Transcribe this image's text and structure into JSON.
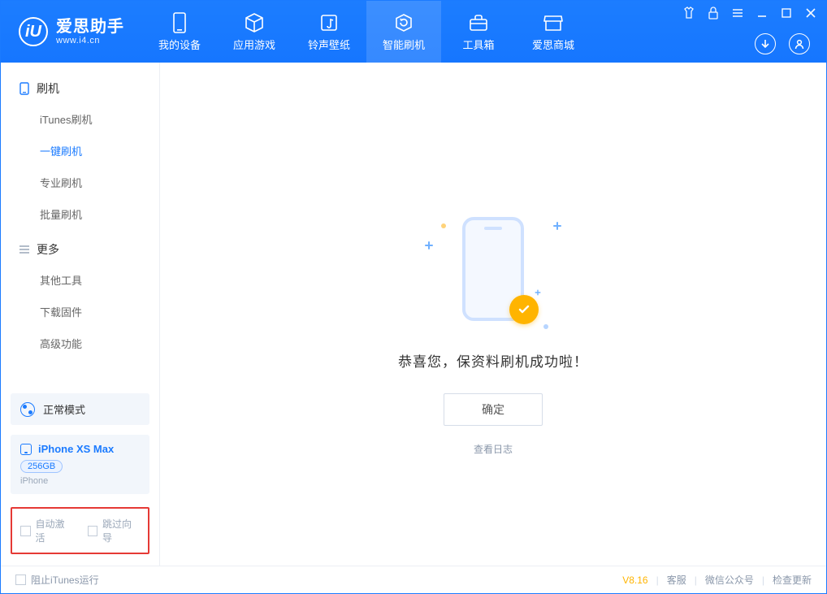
{
  "brand": {
    "title": "爱思助手",
    "subtitle": "www.i4.cn",
    "logo_letter": "iU"
  },
  "tabs": [
    {
      "label": "我的设备",
      "icon": "device-icon"
    },
    {
      "label": "应用游戏",
      "icon": "cube-icon"
    },
    {
      "label": "铃声壁纸",
      "icon": "music-icon"
    },
    {
      "label": "智能刷机",
      "icon": "refresh-icon",
      "active": true
    },
    {
      "label": "工具箱",
      "icon": "toolbox-icon"
    },
    {
      "label": "爱思商城",
      "icon": "store-icon"
    }
  ],
  "sidebar": {
    "sections": [
      {
        "head": "刷机",
        "head_icon": "phone-icon",
        "items": [
          "iTunes刷机",
          "一键刷机",
          "专业刷机",
          "批量刷机"
        ],
        "active_index": 1
      },
      {
        "head": "更多",
        "head_icon": "menu-icon",
        "items": [
          "其他工具",
          "下载固件",
          "高级功能"
        ],
        "active_index": -1
      }
    ],
    "mode": "正常模式",
    "device": {
      "name": "iPhone XS Max",
      "storage": "256GB",
      "type": "iPhone"
    },
    "checks": {
      "auto_activate": "自动激活",
      "skip_guide": "跳过向导"
    }
  },
  "main": {
    "success_text": "恭喜您，保资料刷机成功啦！",
    "ok_button": "确定",
    "log_link": "查看日志"
  },
  "footer": {
    "block_itunes": "阻止iTunes运行",
    "version": "V8.16",
    "links": [
      "客服",
      "微信公众号",
      "检查更新"
    ]
  }
}
